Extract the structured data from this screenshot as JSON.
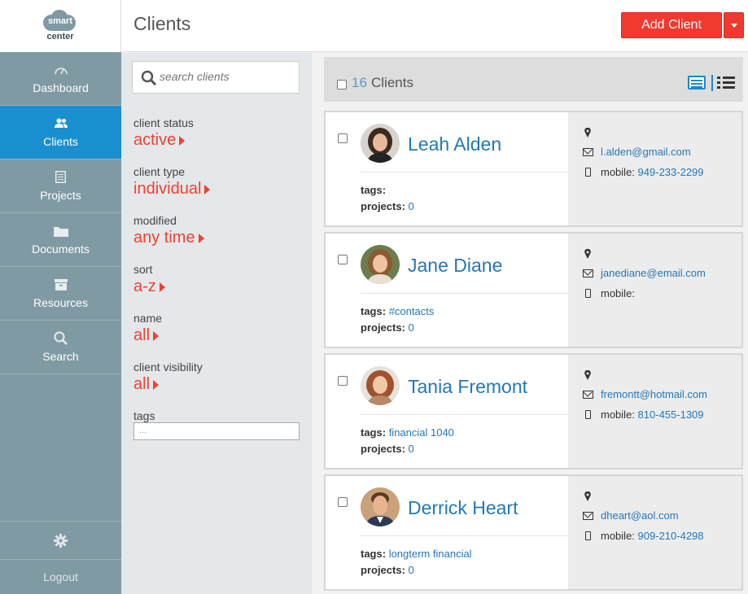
{
  "logo": {
    "line1": "smart",
    "line2": "center"
  },
  "nav": [
    {
      "label": "Dashboard",
      "icon": "dashboard-icon"
    },
    {
      "label": "Clients",
      "icon": "users-icon"
    },
    {
      "label": "Projects",
      "icon": "projects-icon"
    },
    {
      "label": "Documents",
      "icon": "folder-icon"
    },
    {
      "label": "Resources",
      "icon": "archive-icon"
    },
    {
      "label": "Search",
      "icon": "search-icon"
    }
  ],
  "sidebar_bottom": {
    "settings_icon": "gear-icon",
    "logout_label": "Logout"
  },
  "header": {
    "title": "Clients",
    "add_button": "Add Client"
  },
  "search": {
    "placeholder": "search clients"
  },
  "filters": [
    {
      "label": "client status",
      "value": "active"
    },
    {
      "label": "client type",
      "value": "individual"
    },
    {
      "label": "modified",
      "value": "any time"
    },
    {
      "label": "sort",
      "value": "a-z"
    },
    {
      "label": "name",
      "value": "all"
    },
    {
      "label": "client visibility",
      "value": "all"
    }
  ],
  "tags_filter": {
    "label": "tags",
    "placeholder": "..."
  },
  "list_header": {
    "count": "16",
    "label": "Clients"
  },
  "clients": [
    {
      "name": "Leah Alden",
      "tags_label": "tags:",
      "tags": "",
      "projects_label": "projects:",
      "projects": "0",
      "email": "l.alden@gmail.com",
      "mobile_label": "mobile:",
      "mobile": "949-233-2299"
    },
    {
      "name": "Jane Diane",
      "tags_label": "tags:",
      "tags": "#contacts",
      "projects_label": "projects:",
      "projects": "0",
      "email": "janediane@email.com",
      "mobile_label": "mobile:",
      "mobile": ""
    },
    {
      "name": "Tania Fremont",
      "tags_label": "tags:",
      "tags": "financial 1040",
      "projects_label": "projects:",
      "projects": "0",
      "email": "fremontt@hotmail.com",
      "mobile_label": "mobile:",
      "mobile": "810-455-1309"
    },
    {
      "name": "Derrick Heart",
      "tags_label": "tags:",
      "tags": "longterm financial",
      "projects_label": "projects:",
      "projects": "0",
      "email": "dheart@aol.com",
      "mobile_label": "mobile:",
      "mobile": "909-210-4298"
    }
  ],
  "colors": {
    "accent_red": "#f0392f",
    "active_blue": "#1a8fd0",
    "sidebar": "#7f9aa3",
    "link_blue": "#2378b8"
  }
}
